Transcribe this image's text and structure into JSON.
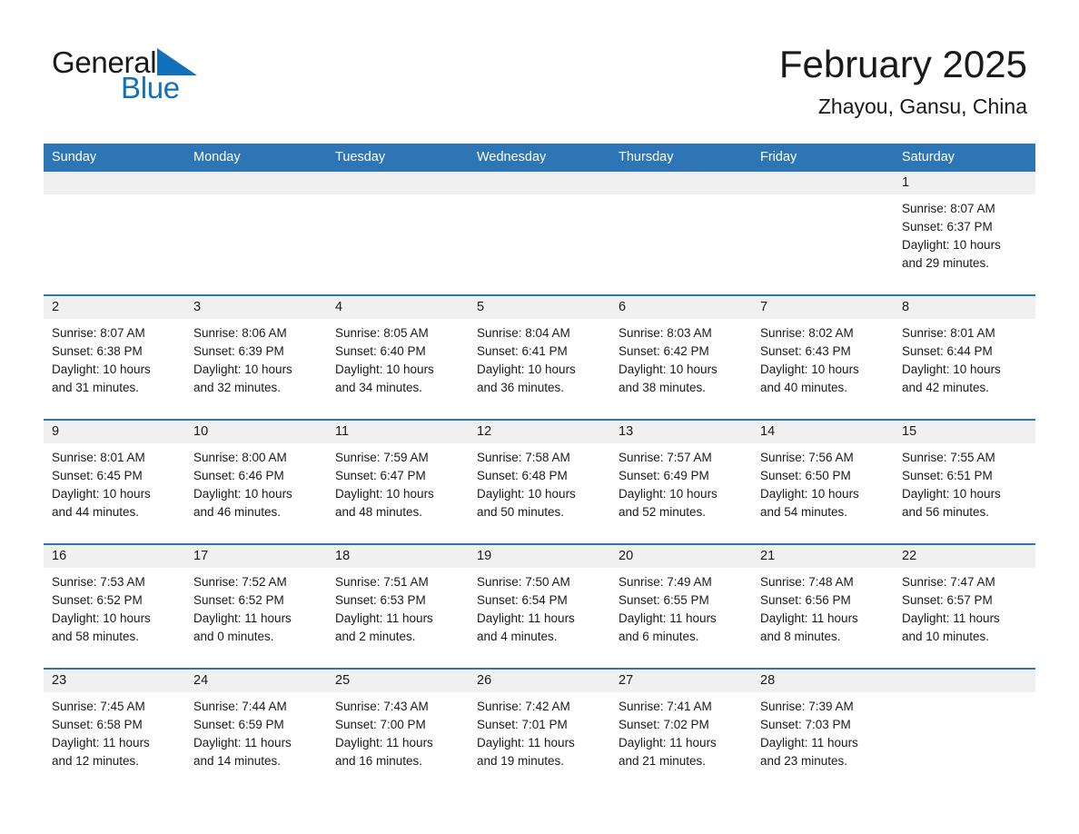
{
  "logo": {
    "word1": "General",
    "word2": "Blue",
    "triangle_color": "#1171bb",
    "word2_color": "#1171bb"
  },
  "header": {
    "month_title": "February 2025",
    "location": "Zhayou, Gansu, China"
  },
  "theme": {
    "header_blue": "#2e75b6",
    "row_separator_blue": "#2e75b6",
    "day_number_bg": "#f0f0f0",
    "text": "#1a1a1a"
  },
  "calendar": {
    "weekday_headers": [
      "Sunday",
      "Monday",
      "Tuesday",
      "Wednesday",
      "Thursday",
      "Friday",
      "Saturday"
    ],
    "weeks": [
      [
        {
          "day": "",
          "sunrise": "",
          "sunset": "",
          "daylight_line1": "",
          "daylight_line2": ""
        },
        {
          "day": "",
          "sunrise": "",
          "sunset": "",
          "daylight_line1": "",
          "daylight_line2": ""
        },
        {
          "day": "",
          "sunrise": "",
          "sunset": "",
          "daylight_line1": "",
          "daylight_line2": ""
        },
        {
          "day": "",
          "sunrise": "",
          "sunset": "",
          "daylight_line1": "",
          "daylight_line2": ""
        },
        {
          "day": "",
          "sunrise": "",
          "sunset": "",
          "daylight_line1": "",
          "daylight_line2": ""
        },
        {
          "day": "",
          "sunrise": "",
          "sunset": "",
          "daylight_line1": "",
          "daylight_line2": ""
        },
        {
          "day": "1",
          "sunrise": "Sunrise: 8:07 AM",
          "sunset": "Sunset: 6:37 PM",
          "daylight_line1": "Daylight: 10 hours",
          "daylight_line2": "and 29 minutes."
        }
      ],
      [
        {
          "day": "2",
          "sunrise": "Sunrise: 8:07 AM",
          "sunset": "Sunset: 6:38 PM",
          "daylight_line1": "Daylight: 10 hours",
          "daylight_line2": "and 31 minutes."
        },
        {
          "day": "3",
          "sunrise": "Sunrise: 8:06 AM",
          "sunset": "Sunset: 6:39 PM",
          "daylight_line1": "Daylight: 10 hours",
          "daylight_line2": "and 32 minutes."
        },
        {
          "day": "4",
          "sunrise": "Sunrise: 8:05 AM",
          "sunset": "Sunset: 6:40 PM",
          "daylight_line1": "Daylight: 10 hours",
          "daylight_line2": "and 34 minutes."
        },
        {
          "day": "5",
          "sunrise": "Sunrise: 8:04 AM",
          "sunset": "Sunset: 6:41 PM",
          "daylight_line1": "Daylight: 10 hours",
          "daylight_line2": "and 36 minutes."
        },
        {
          "day": "6",
          "sunrise": "Sunrise: 8:03 AM",
          "sunset": "Sunset: 6:42 PM",
          "daylight_line1": "Daylight: 10 hours",
          "daylight_line2": "and 38 minutes."
        },
        {
          "day": "7",
          "sunrise": "Sunrise: 8:02 AM",
          "sunset": "Sunset: 6:43 PM",
          "daylight_line1": "Daylight: 10 hours",
          "daylight_line2": "and 40 minutes."
        },
        {
          "day": "8",
          "sunrise": "Sunrise: 8:01 AM",
          "sunset": "Sunset: 6:44 PM",
          "daylight_line1": "Daylight: 10 hours",
          "daylight_line2": "and 42 minutes."
        }
      ],
      [
        {
          "day": "9",
          "sunrise": "Sunrise: 8:01 AM",
          "sunset": "Sunset: 6:45 PM",
          "daylight_line1": "Daylight: 10 hours",
          "daylight_line2": "and 44 minutes."
        },
        {
          "day": "10",
          "sunrise": "Sunrise: 8:00 AM",
          "sunset": "Sunset: 6:46 PM",
          "daylight_line1": "Daylight: 10 hours",
          "daylight_line2": "and 46 minutes."
        },
        {
          "day": "11",
          "sunrise": "Sunrise: 7:59 AM",
          "sunset": "Sunset: 6:47 PM",
          "daylight_line1": "Daylight: 10 hours",
          "daylight_line2": "and 48 minutes."
        },
        {
          "day": "12",
          "sunrise": "Sunrise: 7:58 AM",
          "sunset": "Sunset: 6:48 PM",
          "daylight_line1": "Daylight: 10 hours",
          "daylight_line2": "and 50 minutes."
        },
        {
          "day": "13",
          "sunrise": "Sunrise: 7:57 AM",
          "sunset": "Sunset: 6:49 PM",
          "daylight_line1": "Daylight: 10 hours",
          "daylight_line2": "and 52 minutes."
        },
        {
          "day": "14",
          "sunrise": "Sunrise: 7:56 AM",
          "sunset": "Sunset: 6:50 PM",
          "daylight_line1": "Daylight: 10 hours",
          "daylight_line2": "and 54 minutes."
        },
        {
          "day": "15",
          "sunrise": "Sunrise: 7:55 AM",
          "sunset": "Sunset: 6:51 PM",
          "daylight_line1": "Daylight: 10 hours",
          "daylight_line2": "and 56 minutes."
        }
      ],
      [
        {
          "day": "16",
          "sunrise": "Sunrise: 7:53 AM",
          "sunset": "Sunset: 6:52 PM",
          "daylight_line1": "Daylight: 10 hours",
          "daylight_line2": "and 58 minutes."
        },
        {
          "day": "17",
          "sunrise": "Sunrise: 7:52 AM",
          "sunset": "Sunset: 6:52 PM",
          "daylight_line1": "Daylight: 11 hours",
          "daylight_line2": "and 0 minutes."
        },
        {
          "day": "18",
          "sunrise": "Sunrise: 7:51 AM",
          "sunset": "Sunset: 6:53 PM",
          "daylight_line1": "Daylight: 11 hours",
          "daylight_line2": "and 2 minutes."
        },
        {
          "day": "19",
          "sunrise": "Sunrise: 7:50 AM",
          "sunset": "Sunset: 6:54 PM",
          "daylight_line1": "Daylight: 11 hours",
          "daylight_line2": "and 4 minutes."
        },
        {
          "day": "20",
          "sunrise": "Sunrise: 7:49 AM",
          "sunset": "Sunset: 6:55 PM",
          "daylight_line1": "Daylight: 11 hours",
          "daylight_line2": "and 6 minutes."
        },
        {
          "day": "21",
          "sunrise": "Sunrise: 7:48 AM",
          "sunset": "Sunset: 6:56 PM",
          "daylight_line1": "Daylight: 11 hours",
          "daylight_line2": "and 8 minutes."
        },
        {
          "day": "22",
          "sunrise": "Sunrise: 7:47 AM",
          "sunset": "Sunset: 6:57 PM",
          "daylight_line1": "Daylight: 11 hours",
          "daylight_line2": "and 10 minutes."
        }
      ],
      [
        {
          "day": "23",
          "sunrise": "Sunrise: 7:45 AM",
          "sunset": "Sunset: 6:58 PM",
          "daylight_line1": "Daylight: 11 hours",
          "daylight_line2": "and 12 minutes."
        },
        {
          "day": "24",
          "sunrise": "Sunrise: 7:44 AM",
          "sunset": "Sunset: 6:59 PM",
          "daylight_line1": "Daylight: 11 hours",
          "daylight_line2": "and 14 minutes."
        },
        {
          "day": "25",
          "sunrise": "Sunrise: 7:43 AM",
          "sunset": "Sunset: 7:00 PM",
          "daylight_line1": "Daylight: 11 hours",
          "daylight_line2": "and 16 minutes."
        },
        {
          "day": "26",
          "sunrise": "Sunrise: 7:42 AM",
          "sunset": "Sunset: 7:01 PM",
          "daylight_line1": "Daylight: 11 hours",
          "daylight_line2": "and 19 minutes."
        },
        {
          "day": "27",
          "sunrise": "Sunrise: 7:41 AM",
          "sunset": "Sunset: 7:02 PM",
          "daylight_line1": "Daylight: 11 hours",
          "daylight_line2": "and 21 minutes."
        },
        {
          "day": "28",
          "sunrise": "Sunrise: 7:39 AM",
          "sunset": "Sunset: 7:03 PM",
          "daylight_line1": "Daylight: 11 hours",
          "daylight_line2": "and 23 minutes."
        },
        {
          "day": "",
          "sunrise": "",
          "sunset": "",
          "daylight_line1": "",
          "daylight_line2": ""
        }
      ]
    ]
  }
}
